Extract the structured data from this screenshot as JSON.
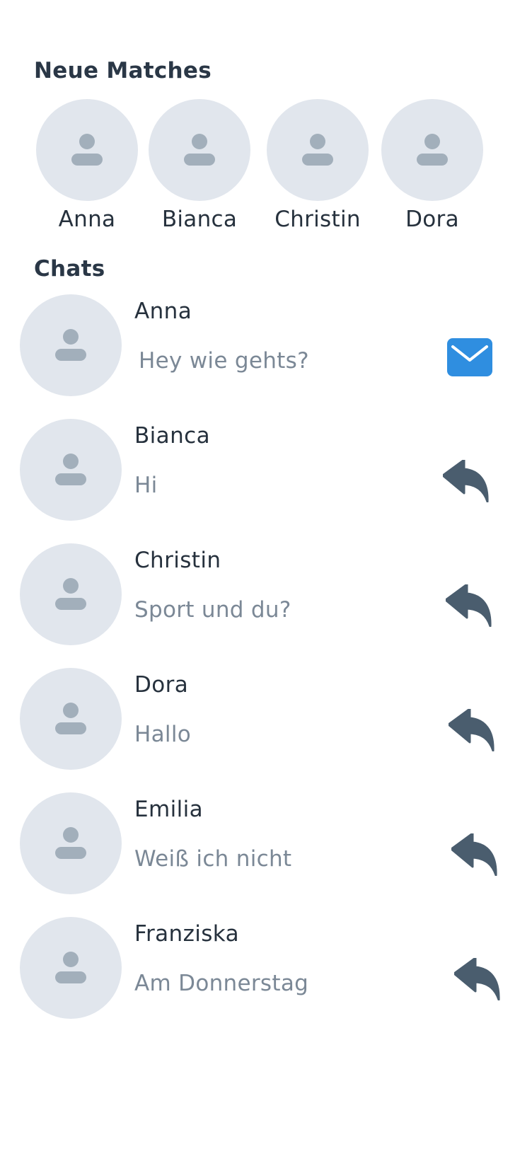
{
  "sections": {
    "matches_title": "Neue Matches",
    "chats_title": "Chats"
  },
  "matches": [
    {
      "name": "Anna"
    },
    {
      "name": "Bianca"
    },
    {
      "name": "Christin"
    },
    {
      "name": "Dora"
    }
  ],
  "chats": [
    {
      "name": "Anna",
      "message": "Hey wie gehts?",
      "status_icon": "envelope-icon"
    },
    {
      "name": "Bianca",
      "message": "Hi",
      "status_icon": "reply-icon"
    },
    {
      "name": "Christin",
      "message": "Sport und du?",
      "status_icon": "reply-icon"
    },
    {
      "name": "Dora",
      "message": "Hallo",
      "status_icon": "reply-icon"
    },
    {
      "name": "Emilia",
      "message": "Weiß ich nicht",
      "status_icon": "reply-icon"
    },
    {
      "name": "Franziska",
      "message": "Am Donnerstag",
      "status_icon": "reply-icon"
    }
  ],
  "colors": {
    "avatar_background": "#e1e6ed",
    "avatar_figure": "#a2afbb",
    "envelope_accent": "#2f8ee0",
    "reply_icon": "#4a5d6e",
    "title_text": "#2a3746",
    "message_text": "#7b8896"
  }
}
